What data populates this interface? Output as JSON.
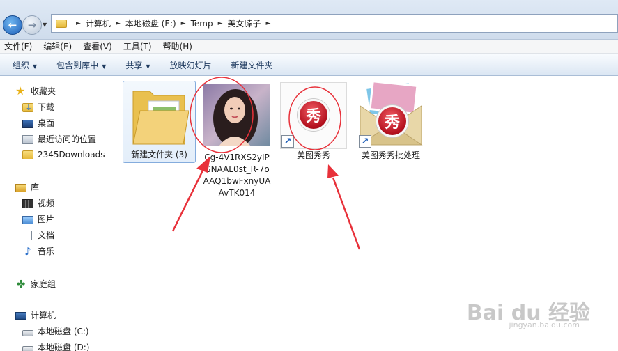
{
  "address": {
    "crumbs": [
      "计算机",
      "本地磁盘 (E:)",
      "Temp",
      "美女脖子"
    ]
  },
  "menu": [
    "文件(F)",
    "编辑(E)",
    "查看(V)",
    "工具(T)",
    "帮助(H)"
  ],
  "commands": {
    "organize": "组织",
    "include_library": "包含到库中",
    "share": "共享",
    "slideshow": "放映幻灯片",
    "new_folder": "新建文件夹"
  },
  "nav": {
    "favorites": "收藏夹",
    "downloads": "下载",
    "desktop": "桌面",
    "recent": "最近访问的位置",
    "downloads2345": "2345Downloads",
    "libraries": "库",
    "videos": "视频",
    "pictures": "图片",
    "documents": "文档",
    "music": "音乐",
    "homegroup": "家庭组",
    "computer": "计算机",
    "drive_c": "本地磁盘 (C:)",
    "drive_d": "本地磁盘 (D:)"
  },
  "files": {
    "folder": "新建文件夹 (3)",
    "photo": "Cg-4V1RXS2yIPGNAAL0st_R-7oAAQ1bwFxnyUAAvTK014",
    "meitu": "美图秀秀",
    "meitu_batch": "美图秀秀批处理",
    "xiu_glyph": "秀"
  },
  "watermark": {
    "brand": "Bai du 经验",
    "url": "jingyan.baidu.com"
  },
  "colors": {
    "annotation": "#e8313a",
    "accent": "#1f5fb8"
  }
}
